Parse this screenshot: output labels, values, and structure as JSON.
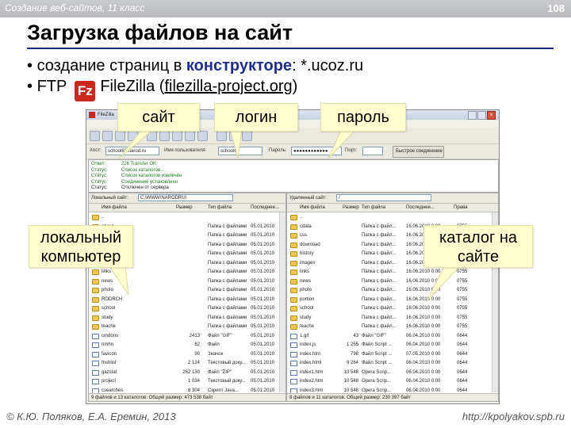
{
  "header": {
    "course": "Создание веб-сайтов, 11 класс",
    "page_number": "108"
  },
  "slide": {
    "title": "Загрузка файлов на сайт",
    "bullet1": {
      "prefix": "создание страниц в ",
      "keyword": "конструкторе",
      "suffix": ": *.ucoz.ru"
    },
    "bullet2": {
      "prefix": "FTP",
      "logo_text": "Fz",
      "app": "FileZilla (",
      "link": "filezilla-project.org",
      "suffix": ")"
    }
  },
  "callouts": {
    "site": "сайт",
    "login": "логин",
    "password": "пароль",
    "local": "локальный\nкомпьютер",
    "remote": "каталог на\nсайте"
  },
  "filezilla": {
    "title": "FileZilla",
    "quickconnect": {
      "host_label": "Хост:",
      "host_value": "school63.narod.ru",
      "user_label": "Имя пользователя:",
      "user_value": "school63",
      "pass_label": "Пароль:",
      "pass_value": "●●●●●●●●●●●●",
      "port_label": "Порт:",
      "connect_label": "Быстрое соединение"
    },
    "log": [
      {
        "type": "Ответ:",
        "text": "226 Transfer OK",
        "color": "#1a7a1a"
      },
      {
        "type": "Статус:",
        "text": "Список каталогов...",
        "color": "#1a7a1a"
      },
      {
        "type": "Статус:",
        "text": "Список каталогов извлечён",
        "color": "#1a7a1a"
      },
      {
        "type": "Статус:",
        "text": "Соединение установлено",
        "color": "#1a7a1a"
      },
      {
        "type": "Статус:",
        "text": "Отключен от сервера",
        "color": "#222222"
      }
    ],
    "local": {
      "site_label": "Локальный сайт:",
      "site_value": "C:\\WWW\\NARODRU\\",
      "columns": [
        "Имя файла",
        "Размер",
        "Тип файла",
        "Последнее..."
      ],
      "rows": [
        {
          "name": "..",
          "size": "",
          "type": "",
          "date": "",
          "kind": "folder"
        },
        {
          "name": "about",
          "size": "",
          "type": "Папка с файлами",
          "date": "05.01.2010",
          "kind": "folder"
        },
        {
          "name": "css",
          "size": "",
          "type": "Папка с файлами",
          "date": "05.01.2010",
          "kind": "folder"
        },
        {
          "name": "download",
          "size": "",
          "type": "Папка с файлами",
          "date": "05.01.2010",
          "kind": "folder"
        },
        {
          "name": "history",
          "size": "",
          "type": "Папка с файлами",
          "date": "05.01.2010",
          "kind": "folder"
        },
        {
          "name": "images",
          "size": "",
          "type": "Папка с файлами",
          "date": "05.01.2010",
          "kind": "folder"
        },
        {
          "name": "links",
          "size": "",
          "type": "Папка с файлами",
          "date": "05.01.2010",
          "kind": "folder"
        },
        {
          "name": "news",
          "size": "",
          "type": "Папка с файлами",
          "date": "05.01.2010",
          "kind": "folder"
        },
        {
          "name": "photo",
          "size": "",
          "type": "Папка с файлами",
          "date": "05.01.2010",
          "kind": "folder"
        },
        {
          "name": "RODRCH",
          "size": "",
          "type": "Папка с файлами",
          "date": "05.01.2010",
          "kind": "folder"
        },
        {
          "name": "school",
          "size": "",
          "type": "Папка с файлами",
          "date": "05.01.2010",
          "kind": "folder"
        },
        {
          "name": "study",
          "size": "",
          "type": "Папка с файлами",
          "date": "05.01.2010",
          "kind": "folder"
        },
        {
          "name": "teache",
          "size": "",
          "type": "Папка с файлами",
          "date": "05.01.2010",
          "kind": "folder"
        },
        {
          "name": "cmdons",
          "size": "2413",
          "type": "Файл \"GIF\"",
          "date": "05.01.2010",
          "kind": "file"
        },
        {
          "name": "nmhn",
          "size": "82",
          "type": "Файл",
          "date": "05.01.2010",
          "kind": "file"
        },
        {
          "name": "favicon",
          "size": "90",
          "type": "Значок",
          "date": "05.01.2010",
          "kind": "file"
        },
        {
          "name": "fnshlist",
          "size": "2 124",
          "type": "Текстовый доку...",
          "date": "05.01.2010",
          "kind": "file"
        },
        {
          "name": "gazstat",
          "size": "262 130",
          "type": "Файл \"ZIP\"",
          "date": "05.01.2010",
          "kind": "file"
        },
        {
          "name": "project",
          "size": "1 034",
          "type": "Текстовый доку...",
          "date": "05.01.2010",
          "kind": "file"
        },
        {
          "name": "csearches",
          "size": "8 304",
          "type": "Скрипт Java...",
          "date": "05.01.2010",
          "kind": "file"
        }
      ],
      "status": "9 файлов и 13 каталогов. Общий размер: 473 538 байт"
    },
    "remote": {
      "site_label": "Удаленный сайт:",
      "site_value": "/",
      "columns": [
        "Имя файла",
        "Размер",
        "Тип файла",
        "Последнее...",
        "Права"
      ],
      "rows": [
        {
          "name": "..",
          "size": "",
          "type": "",
          "date": "",
          "perm": "",
          "kind": "folder"
        },
        {
          "name": "cdata",
          "size": "",
          "type": "Папка с файл...",
          "date": "16.06.2010 0:00",
          "perm": "0755",
          "kind": "folder"
        },
        {
          "name": "css",
          "size": "",
          "type": "Папка с файл...",
          "date": "16.06.2010 0:00",
          "perm": "0755",
          "kind": "folder"
        },
        {
          "name": "download",
          "size": "",
          "type": "Папка с файл...",
          "date": "16.06.2010 0:00",
          "perm": "0755",
          "kind": "folder"
        },
        {
          "name": "history",
          "size": "",
          "type": "Папка с файл...",
          "date": "16.06.2010 0:00",
          "perm": "0755",
          "kind": "folder"
        },
        {
          "name": "images",
          "size": "",
          "type": "Папка с файл...",
          "date": "16.06.2010 0:00",
          "perm": "0755",
          "kind": "folder"
        },
        {
          "name": "links",
          "size": "",
          "type": "Папка с файл...",
          "date": "16.06.2010 0:00",
          "perm": "0755",
          "kind": "folder"
        },
        {
          "name": "news",
          "size": "",
          "type": "Папка с файл...",
          "date": "16.06.2010 0:00",
          "perm": "0755",
          "kind": "folder"
        },
        {
          "name": "photo",
          "size": "",
          "type": "Папка с файл...",
          "date": "16.06.2010 0:00",
          "perm": "0755",
          "kind": "folder"
        },
        {
          "name": "portion",
          "size": "",
          "type": "Папка с файл...",
          "date": "16.06.2010 0:00",
          "perm": "0755",
          "kind": "folder"
        },
        {
          "name": "school",
          "size": "",
          "type": "Папка с файл...",
          "date": "16.06.2010 0:00",
          "perm": "0755",
          "kind": "folder"
        },
        {
          "name": "study",
          "size": "",
          "type": "Папка с файл...",
          "date": "16.06.2010 0:00",
          "perm": "0755",
          "kind": "folder"
        },
        {
          "name": "teache",
          "size": "",
          "type": "Папка с файл...",
          "date": "16.06.2010 0:00",
          "perm": "0755",
          "kind": "folder"
        },
        {
          "name": "1.gif",
          "size": "43",
          "type": "Файл \"GIF\"",
          "date": "06.04.2010 0:00",
          "perm": "0644",
          "kind": "file"
        },
        {
          "name": "index.js",
          "size": "1 255",
          "type": "Файл Script ...",
          "date": "06.04.2010 0:00",
          "perm": "0644",
          "kind": "file"
        },
        {
          "name": "index.htm",
          "size": "798",
          "type": "Файл Script ...",
          "date": "07.05.2010 0:00",
          "perm": "0644",
          "kind": "file"
        },
        {
          "name": "index.html",
          "size": "9 264",
          "type": "Файл Script ...",
          "date": "06.04.2010 0:00",
          "perm": "0644",
          "kind": "file"
        },
        {
          "name": "index1.htm",
          "size": "10 548",
          "type": "Opera Scrip...",
          "date": "06.04.2010 0:00",
          "perm": "0644",
          "kind": "file"
        },
        {
          "name": "index2.htm",
          "size": "10 548",
          "type": "Opera Scrip...",
          "date": "06.04.2010 0:00",
          "perm": "0644",
          "kind": "file"
        },
        {
          "name": "index3.htm",
          "size": "10 548",
          "type": "Opera Scrip...",
          "date": "06.04.2010 0:00",
          "perm": "0644",
          "kind": "file"
        }
      ],
      "status": "8 файлов и 11 каталогов. Общий размер: 230 397 байт"
    }
  },
  "footer": {
    "authors": "© К.Ю. Поляков, Е.А. Еремин, 2013",
    "url": "http://kpolyakov.spb.ru"
  }
}
